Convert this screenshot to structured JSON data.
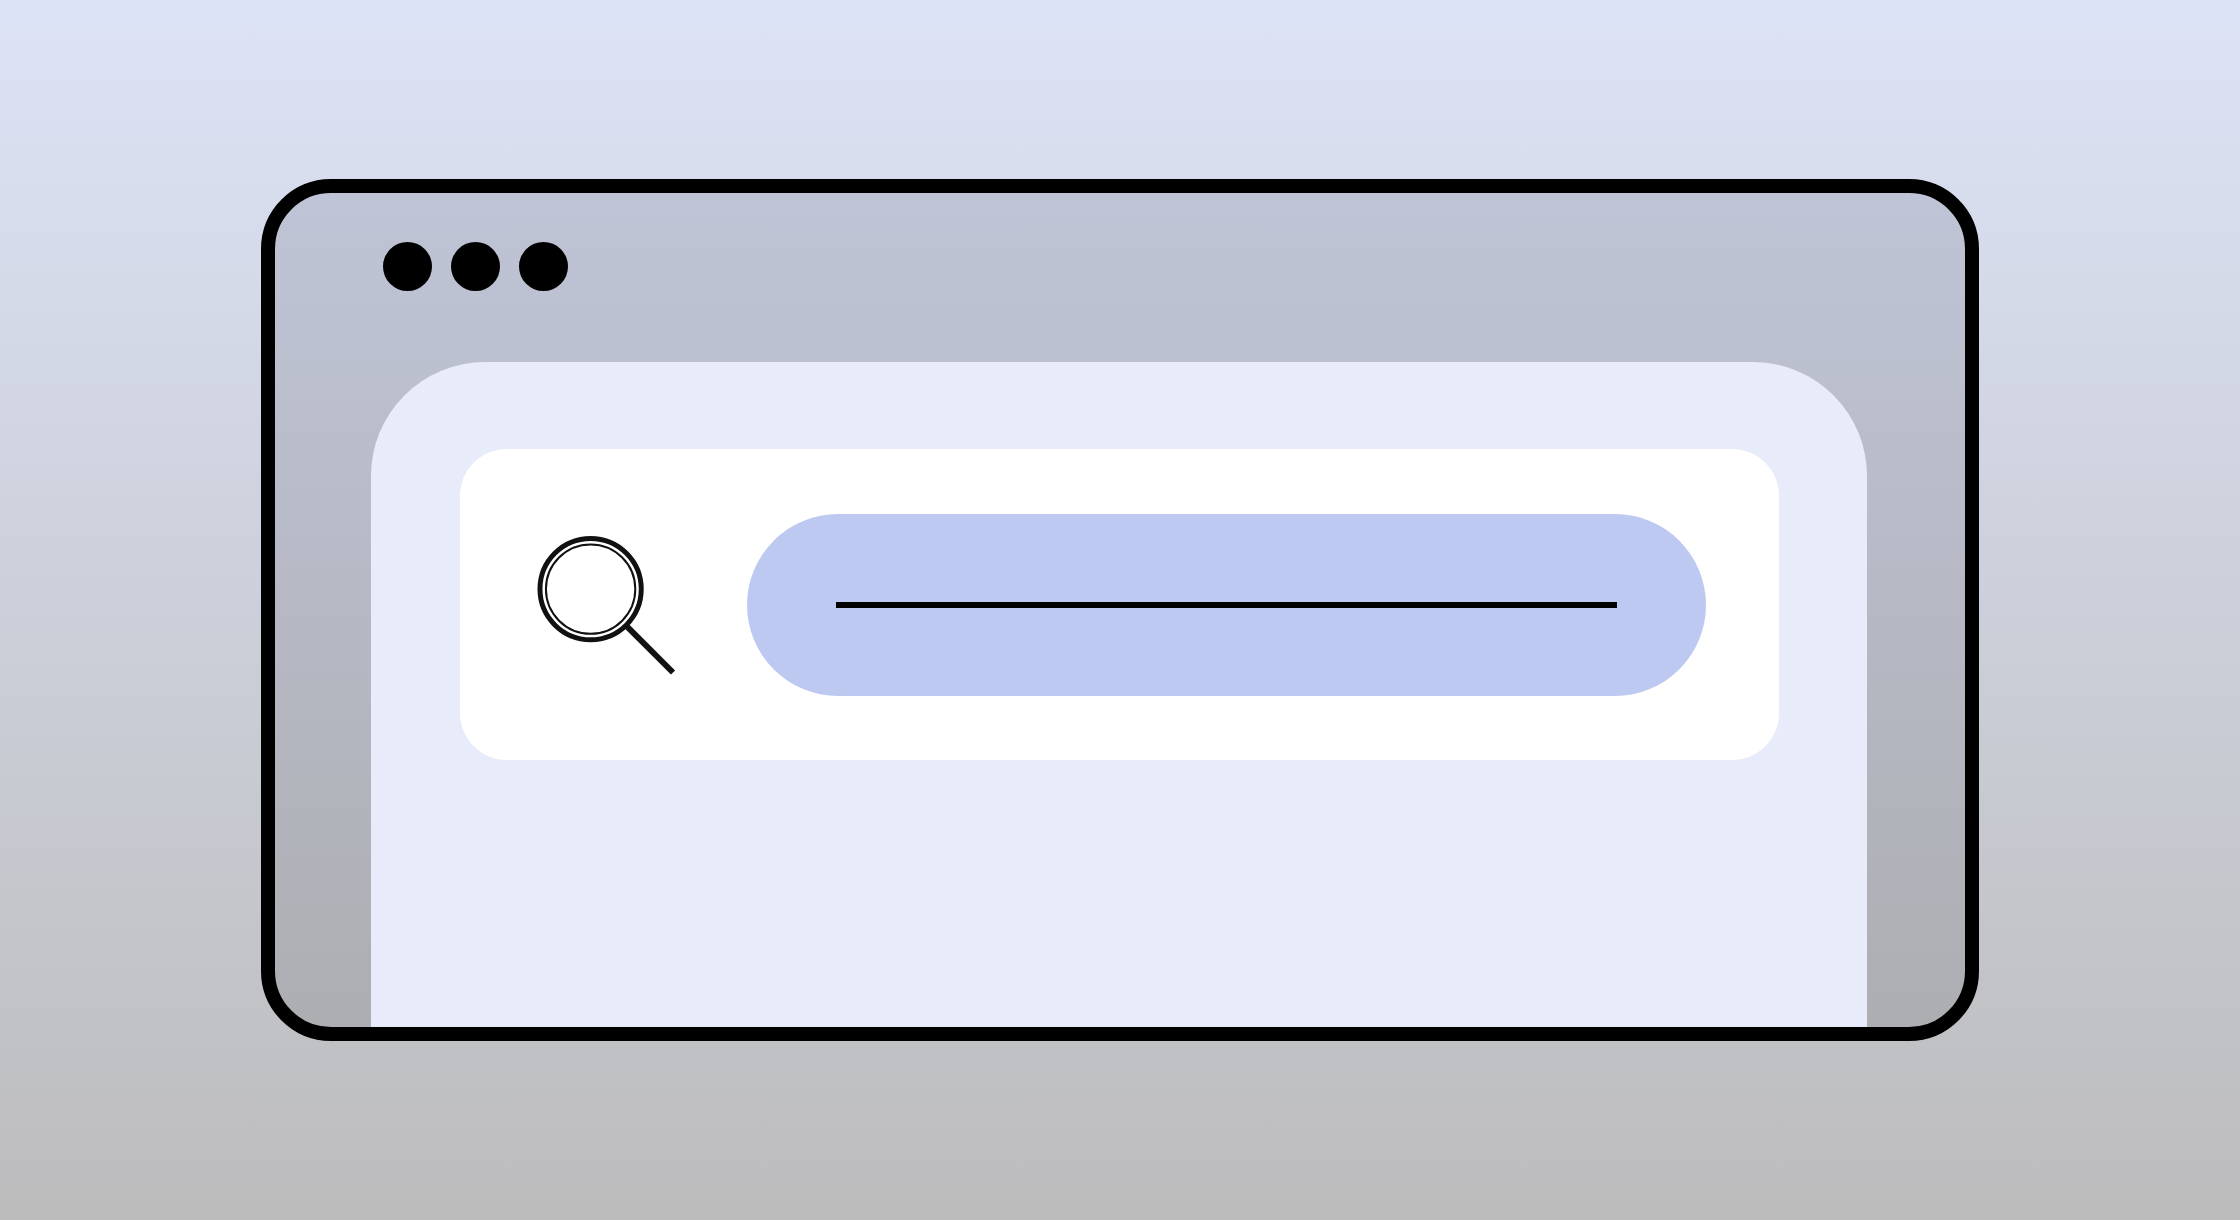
{
  "window": {
    "controls": [
      {
        "kind": "dot"
      },
      {
        "kind": "dot"
      },
      {
        "kind": "dot"
      }
    ]
  },
  "search": {
    "kind": "pill"
  }
}
